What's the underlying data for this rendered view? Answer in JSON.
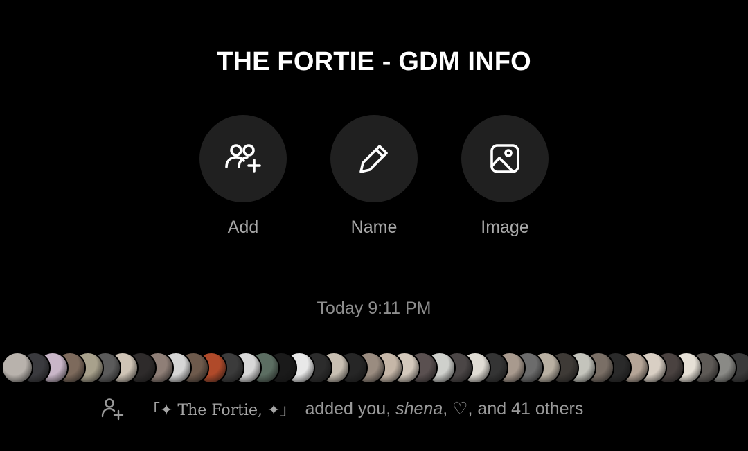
{
  "header": {
    "title": "THE FORTIE - GDM INFO"
  },
  "actions": [
    {
      "label": "Add",
      "icon": "add-people-icon"
    },
    {
      "label": "Name",
      "icon": "pencil-icon"
    },
    {
      "label": "Image",
      "icon": "image-icon"
    }
  ],
  "timestamp": "Today 9:11 PM",
  "avatar_strip": {
    "colors": [
      "#b8b2ac",
      "#3a3a3e",
      "#c9b6c8",
      "#7d6a5c",
      "#a8a18c",
      "#5b5b5b",
      "#cfc4b6",
      "#2e2b2b",
      "#8f7f77",
      "#d6d6d6",
      "#6e5a4c",
      "#b04a2a",
      "#3b3b3b",
      "#d8d8d8",
      "#5c6e62",
      "#1a1a1a",
      "#e8e8e8",
      "#2c2c2c",
      "#c8bfb2",
      "#262626",
      "#9a8c80",
      "#c6b7a8",
      "#d4c9bc",
      "#5a5050",
      "#cfd0cc",
      "#4b4646",
      "#e0dcd4",
      "#343434",
      "#a89a8e",
      "#6c6c6c",
      "#b9b0a2",
      "#3e3a36",
      "#c4c4bc",
      "#7a6f66",
      "#2a2a2a",
      "#b5a597",
      "#d9cfc4",
      "#4a4240",
      "#e6e0d6",
      "#5e5a56",
      "#8a8a86",
      "#3a3a3a"
    ]
  },
  "system_message": {
    "icon": "person-add-icon",
    "group_name": "「✦ The Fortie, ✦」",
    "text_prefix": "added you, ",
    "name_italic": "shena",
    "text_suffix": ", ♡, and 41 others"
  }
}
